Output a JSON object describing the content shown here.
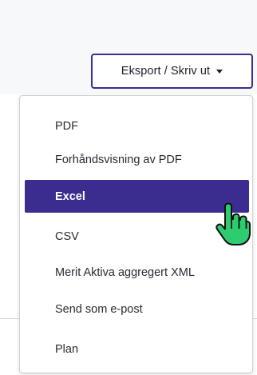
{
  "export_button": {
    "label": "Eksport / Skriv ut",
    "icon": "chevron-down-icon"
  },
  "menu": {
    "items": [
      {
        "label": "PDF",
        "selected": false
      },
      {
        "label": "Forhåndsvisning av PDF",
        "selected": false
      },
      {
        "label": "Excel",
        "selected": true
      },
      {
        "label": "CSV",
        "selected": false
      },
      {
        "label": "Merit Aktiva aggregert XML",
        "selected": false
      },
      {
        "label": "Send som e-post",
        "selected": false
      },
      {
        "label": "Plan",
        "selected": false
      }
    ]
  },
  "colors": {
    "accent": "#3b2d8f",
    "cursor": "#2ecc71"
  },
  "cursor": {
    "icon": "hand-pointer-icon"
  }
}
